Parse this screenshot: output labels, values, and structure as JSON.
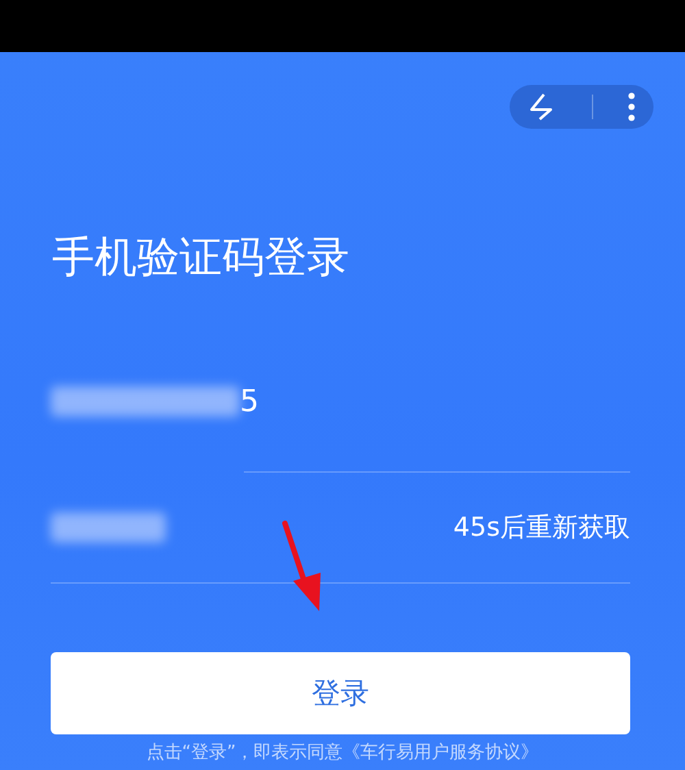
{
  "title": "手机验证码登录",
  "phone_field": {
    "value": "5"
  },
  "code_field": {
    "resend": "45s后重新获取"
  },
  "login_button": {
    "label": "登录"
  },
  "agreement": "点击“登录”，即表示同意《车行易用户服务协议》"
}
